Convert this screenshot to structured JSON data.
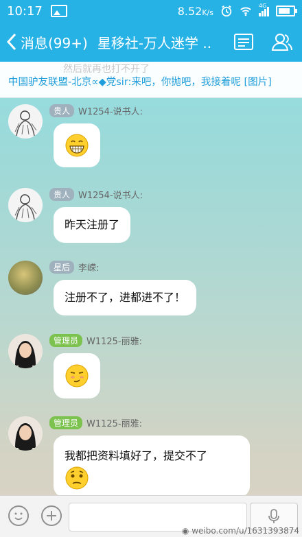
{
  "status_bar": {
    "time": "10:17",
    "speed": "8.52",
    "speed_unit": "K/s",
    "network": "4G"
  },
  "header": {
    "back_label": "消息(99+)",
    "title": "星移社-万人迷学 .."
  },
  "notice": {
    "ghost_text": "然后就再也打不开了",
    "text": "中国驴友联盟-北京∝◆党sir:来吧，你抛吧，我接着呢 [图片]"
  },
  "messages": [
    {
      "badge": "贵人",
      "sender": "W1254-说书人:",
      "text": ""
    },
    {
      "badge": "贵人",
      "sender": "W1254-说书人:",
      "text": "昨天注册了"
    },
    {
      "badge": "星后",
      "sender": "李嵘:",
      "text": "注册不了，进都进不了！"
    },
    {
      "badge": "管理员",
      "sender": "W1125-丽雅:",
      "text": ""
    },
    {
      "badge": "管理员",
      "sender": "W1125-丽雅:",
      "text": "我都把资料填好了，提交不了"
    }
  ],
  "input_bar": {
    "placeholder": ""
  },
  "watermark": "weibo.com/u/1631393874",
  "colors": {
    "accent": "#27b2e6",
    "notice_text": "#1f9edb",
    "badge_gray": "#9fb1bd",
    "badge_green": "#7cc24f"
  }
}
